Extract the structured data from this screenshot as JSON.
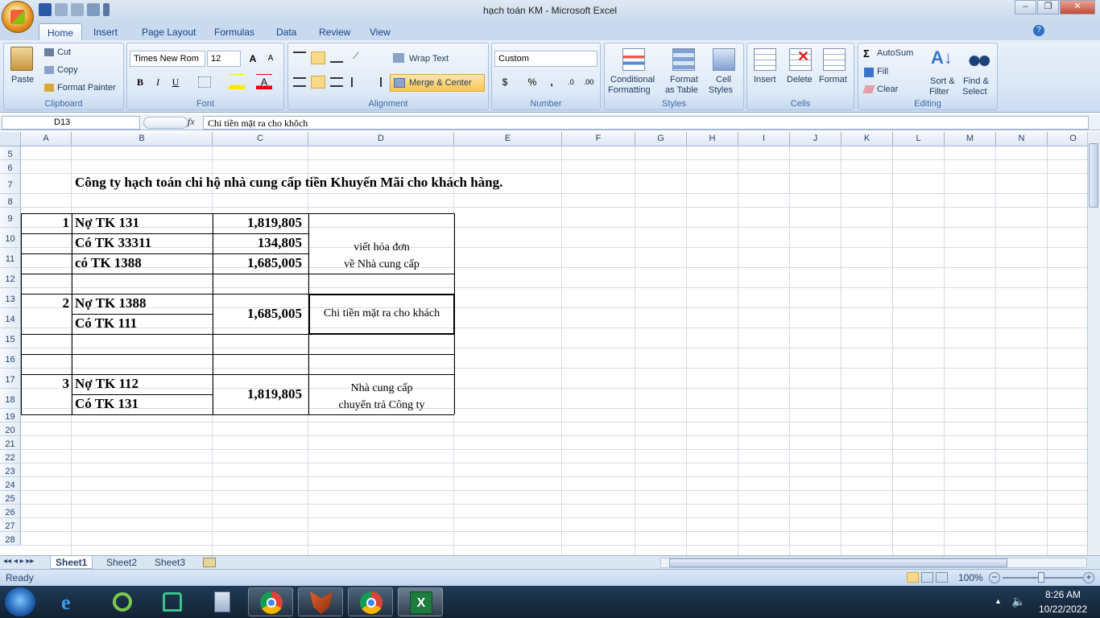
{
  "window": {
    "title": "hạch toán KM - Microsoft Excel",
    "min": "‒",
    "restore": "❐",
    "close": "✕"
  },
  "tabs": [
    "Home",
    "Insert",
    "Page Layout",
    "Formulas",
    "Data",
    "Review",
    "View"
  ],
  "ribbon": {
    "clipboard": {
      "label": "Clipboard",
      "paste": "Paste",
      "cut": "Cut",
      "copy": "Copy",
      "format_painter": "Format Painter"
    },
    "font": {
      "label": "Font",
      "name": "Times New Rom",
      "size": "12",
      "bold": "B",
      "italic": "I",
      "underline": "U"
    },
    "alignment": {
      "label": "Alignment",
      "wrap": "Wrap Text",
      "merge": "Merge & Center"
    },
    "number": {
      "label": "Number",
      "format": "Custom",
      "currency": "$",
      "percent": "%",
      "comma": ","
    },
    "styles": {
      "label": "Styles",
      "conditional": "Conditional",
      "conditional2": "Formatting",
      "format_table": "Format",
      "format_table2": "as Table",
      "cell_styles": "Cell",
      "cell_styles2": "Styles"
    },
    "cells": {
      "label": "Cells",
      "insert": "Insert",
      "delete": "Delete",
      "format": "Format"
    },
    "editing": {
      "label": "Editing",
      "autosum": "AutoSum",
      "fill": "Fill",
      "clear": "Clear",
      "sort": "Sort &",
      "sort2": "Filter",
      "find": "Find &",
      "find2": "Select"
    }
  },
  "formula_bar": {
    "name_box": "D13",
    "fx": "fx",
    "content": "Chi tiền mặt ra cho khôch"
  },
  "columns": [
    "A",
    "B",
    "C",
    "D",
    "E",
    "F",
    "G",
    "H",
    "I",
    "J",
    "K",
    "L",
    "M",
    "N",
    "O"
  ],
  "rows": [
    "5",
    "6",
    "7",
    "8",
    "9",
    "10",
    "11",
    "12",
    "13",
    "14",
    "15",
    "16",
    "17",
    "18",
    "19",
    "20",
    "21",
    "22",
    "23",
    "24",
    "25",
    "26",
    "27",
    "28"
  ],
  "cells": {
    "title": "Công ty hạch toán chi hộ nhà cung cấp tiền Khuyến Mãi cho khách hàng.",
    "r9a": "1",
    "r9b": "Nợ TK 131",
    "r9c": "1,819,805",
    "r10b": "Có TK 33311",
    "r10c": "134,805",
    "r11b": "có TK 1388",
    "r11c": "1,685,005",
    "d9_line1": "viết hóa đơn",
    "d9_line2": "về Nhà cung cấp",
    "r13a": "2",
    "r13b": "Nợ TK 1388",
    "r13c": "1,685,005",
    "d13": "Chi tiền mặt ra cho khách",
    "r14b": "Có TK 111",
    "r17a": "3",
    "r17b": "Nợ TK 112",
    "r17c": "1,819,805",
    "d17_line1": "Nhà cung cấp",
    "d17_line2": "chuyển trả Công ty",
    "r18b": "Có TK 131"
  },
  "sheets": [
    "Sheet1",
    "Sheet2",
    "Sheet3"
  ],
  "status": {
    "ready": "Ready",
    "zoom": "100%"
  },
  "taskbar": {
    "time": "8:26 AM",
    "date": "10/22/2022"
  }
}
